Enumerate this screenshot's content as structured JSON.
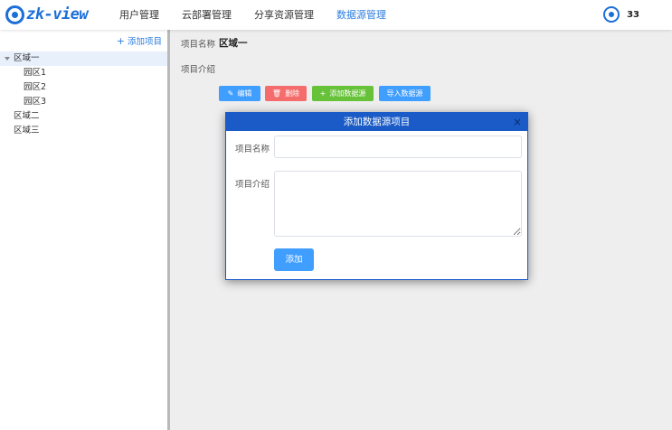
{
  "app": {
    "logo_text": "zk-view"
  },
  "nav": {
    "items": [
      {
        "label": "用户管理"
      },
      {
        "label": "云部署管理"
      },
      {
        "label": "分享资源管理"
      },
      {
        "label": "数据源管理"
      }
    ],
    "active_index": 3
  },
  "user": {
    "name": "33"
  },
  "sidebar": {
    "add_label": "添加项目",
    "tree": [
      {
        "label": "区域一",
        "expanded": true,
        "selected": true
      },
      {
        "label": "园区1"
      },
      {
        "label": "园区2"
      },
      {
        "label": "园区3"
      },
      {
        "label": "区域二"
      },
      {
        "label": "区域三"
      }
    ]
  },
  "detail": {
    "name_label": "项目名称",
    "name_value": "区域一",
    "intro_label": "项目介绍",
    "buttons": {
      "edit": "编辑",
      "delete": "删除",
      "add_datasource": "添加数据源",
      "import_datasource": "导入数据源"
    }
  },
  "dialog": {
    "title": "添加数据源项目",
    "close": "×",
    "name_label": "项目名称",
    "name_value": "",
    "intro_label": "项目介绍",
    "intro_value": "",
    "submit_label": "添加"
  },
  "colors": {
    "brand": "#1c6fd8",
    "nav_active": "#2b7de0",
    "dialog_header": "#1a5bc7",
    "primary": "#409eff",
    "danger": "#f56c6c",
    "success": "#67c23a"
  }
}
